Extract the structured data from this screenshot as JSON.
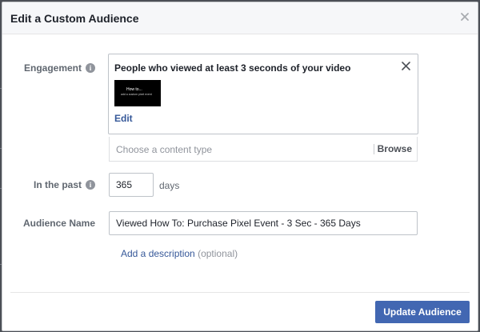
{
  "dialog": {
    "title": "Edit a Custom Audience"
  },
  "engagement": {
    "label": "Engagement",
    "selected_title": "People who viewed at least 3 seconds of your video",
    "thumbnail_title": "How to...",
    "thumbnail_subtitle": "add a custom pixel event",
    "edit_label": "Edit",
    "content_placeholder": "Choose a content type",
    "browse_label": "Browse"
  },
  "in_the_past": {
    "label": "In the past",
    "value": "365",
    "unit": "days"
  },
  "audience_name": {
    "label": "Audience Name",
    "value": "Viewed How To: Purchase Pixel Event - 3 Sec - 365 Days"
  },
  "description": {
    "link_label": "Add a description",
    "optional_label": "(optional)"
  },
  "footer": {
    "update_label": "Update Audience"
  },
  "colors": {
    "primary": "#4267b2",
    "link": "#365899",
    "label": "#606770"
  }
}
